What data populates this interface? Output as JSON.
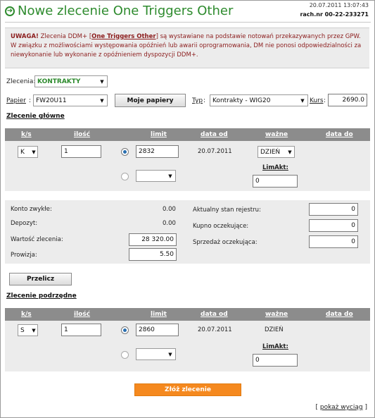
{
  "header": {
    "title": "Nowe zlecenie One Triggers Other",
    "datetime": "20.07.2011 13:07:43",
    "account": "rach.nr 00-22-233271"
  },
  "warning": {
    "prefix": "UWAGA!",
    "text1": " Zlecenia DDM+ [",
    "link": "One Triggers Other",
    "text2": "] są wystawiane na podstawie notowań przekazywanych przez GPW. W związku z możliwościami występowania opóźnień lub awarii oprogramowania, DM nie ponosi odpowiedzialności za niewykonanie lub wykonanie z opóźnieniem dyspozycji DDM+."
  },
  "form": {
    "zlecenia_label": "Zlecenia:",
    "zlecenia_value": "KONTRAKTY",
    "papier_label": "Papier",
    "papier_value": "FW20U11",
    "moje_papiery": "Moje papiery",
    "typ_label": "Typ",
    "typ_value": "Kontrakty - WIG20",
    "kurs_label": "Kurs",
    "kurs_value": "2690.0"
  },
  "main_order": {
    "title": "Zlecenie główne",
    "columns": [
      "k/s",
      "ilość",
      "limit",
      "data od",
      "ważne",
      "data do"
    ],
    "ks": "K",
    "ilosc": "1",
    "limit": "2832",
    "data_od": "20.07.2011",
    "wazne": "DZIEŃ",
    "limakt_label": "LimAkt:",
    "limakt_value": "0"
  },
  "summary": {
    "konto_label": "Konto zwykłe:",
    "konto_value": "0.00",
    "depozyt_label": "Depozyt:",
    "depozyt_value": "0.00",
    "wartosc_label": "Wartość zlecenia:",
    "wartosc_value": "28 320.00",
    "prowizja_label": "Prowizja:",
    "prowizja_value": "5.50",
    "aktualny_label": "Aktualny stan rejestru:",
    "aktualny_value": "0",
    "kupno_label": "Kupno oczekujące:",
    "kupno_value": "0",
    "sprzedaz_label": "Sprzedaż oczekująca:",
    "sprzedaz_value": "0",
    "przelicz": "Przelicz"
  },
  "sub_order": {
    "title": "Zlecenie podrzędne",
    "columns": [
      "k/s",
      "ilość",
      "limit",
      "data od",
      "ważne",
      "data do"
    ],
    "ks": "S",
    "ilosc": "1",
    "limit": "2860",
    "data_od": "20.07.2011",
    "wazne": "DZIEŃ",
    "limakt_label": "LimAkt:",
    "limakt_value": "0"
  },
  "actions": {
    "submit": "Złóż zlecenie",
    "show_extract_open": "[ ",
    "show_extract": "pokaż wyciąg",
    "show_extract_close": " ]"
  },
  "colors": {
    "accent_green": "#2e8b2e",
    "warning_red": "#8b1c1c",
    "submit_orange": "#f5891f",
    "table_header": "#8c8c8c"
  }
}
